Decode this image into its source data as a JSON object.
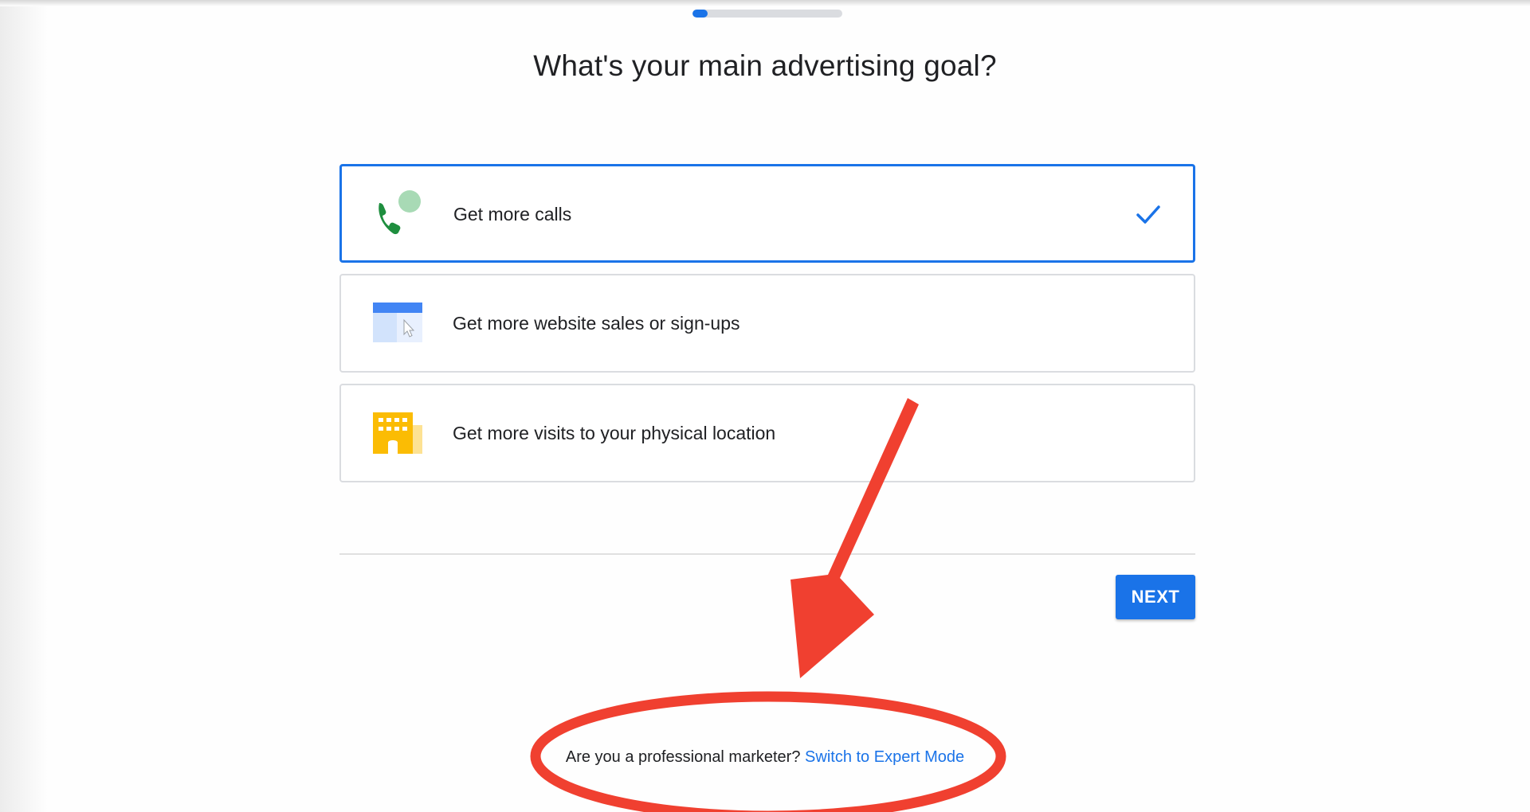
{
  "progress": {
    "fraction": 0.1
  },
  "title": "What's your main advertising goal?",
  "goals": [
    {
      "label": "Get more calls",
      "icon": "phone-icon",
      "selected": true
    },
    {
      "label": "Get more website sales or sign-ups",
      "icon": "browser-window-icon",
      "selected": false
    },
    {
      "label": "Get more visits to your physical location",
      "icon": "building-icon",
      "selected": false
    }
  ],
  "next_button": {
    "label": "NEXT"
  },
  "footer": {
    "question": "Are you a professional marketer?",
    "link": "Switch to Expert Mode"
  },
  "colors": {
    "accent": "#1a73e8",
    "annotation": "#f04030",
    "phone_green": "#1e8e3e",
    "bubble_green": "#a8dab5",
    "building_yellow": "#fbbc04"
  }
}
